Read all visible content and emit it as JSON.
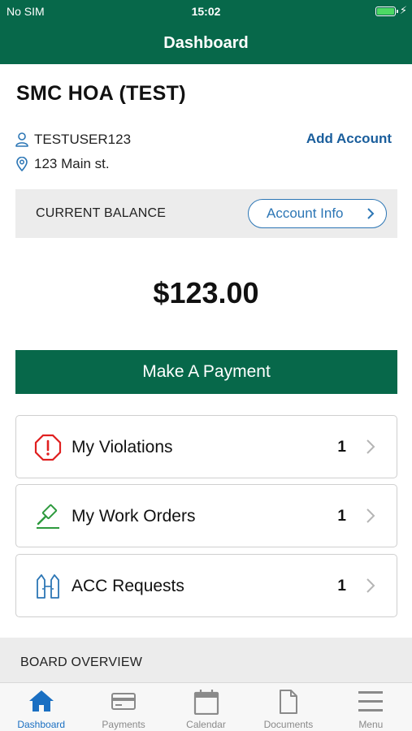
{
  "status_bar": {
    "carrier": "No SIM",
    "time": "15:02",
    "battery_level": 1.0
  },
  "nav": {
    "title": "Dashboard"
  },
  "account": {
    "hoa_name": "SMC HOA (TEST)",
    "username": "TESTUSER123",
    "address": "123 Main st.",
    "add_account_label": "Add Account"
  },
  "balance": {
    "label": "CURRENT BALANCE",
    "account_info_label": "Account Info",
    "amount": "$123.00"
  },
  "payment": {
    "button_label": "Make A Payment"
  },
  "items": [
    {
      "label": "My Violations",
      "count": "1",
      "icon": "violation-octagon-icon",
      "color": "#e02020"
    },
    {
      "label": "My Work Orders",
      "count": "1",
      "icon": "hammer-icon",
      "color": "#2e9a3e"
    },
    {
      "label": "ACC Requests",
      "count": "1",
      "icon": "request-doors-icon",
      "color": "#2c76b5"
    }
  ],
  "board": {
    "label": "BOARD OVERVIEW"
  },
  "tabs": [
    {
      "label": "Dashboard",
      "icon": "home-icon",
      "active": true
    },
    {
      "label": "Payments",
      "icon": "credit-card-icon",
      "active": false
    },
    {
      "label": "Calendar",
      "icon": "calendar-icon",
      "active": false
    },
    {
      "label": "Documents",
      "icon": "document-icon",
      "active": false
    },
    {
      "label": "Menu",
      "icon": "menu-icon",
      "active": false
    }
  ],
  "colors": {
    "brand": "#07684a",
    "link": "#1a5e9c",
    "tab_active": "#1a6fc2",
    "tab_inactive": "#8a8a8a"
  }
}
